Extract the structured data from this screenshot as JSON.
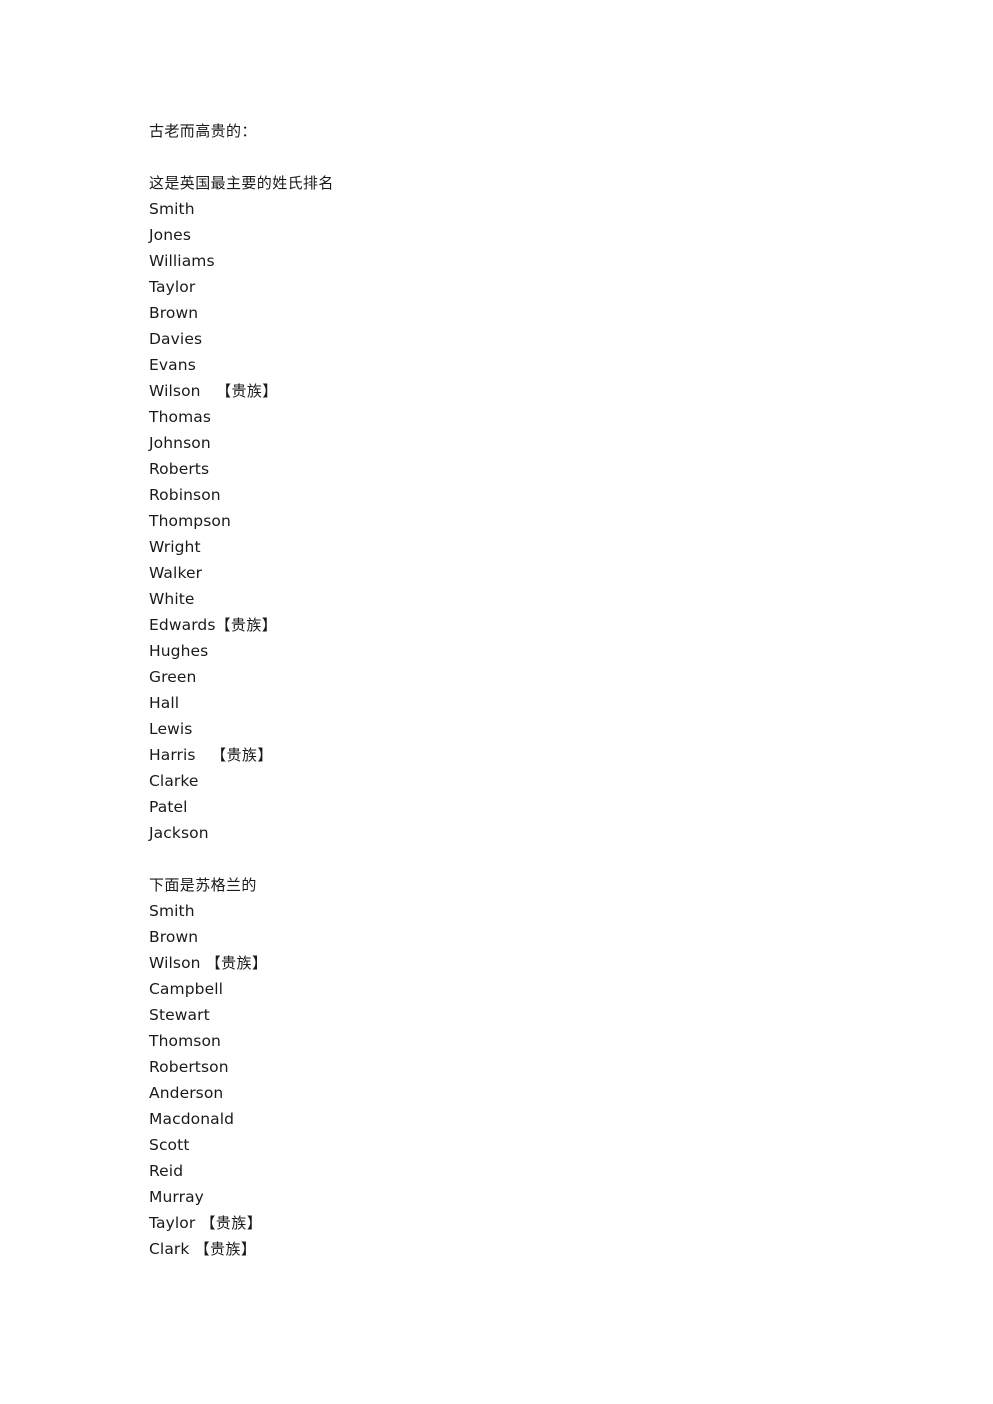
{
  "document": {
    "heading": "古老而高贵的：",
    "sections": [
      {
        "title": "这是英国最主要的姓氏排名",
        "entries": [
          {
            "name": "Smith",
            "gap": "",
            "tag": ""
          },
          {
            "name": "Jones",
            "gap": "",
            "tag": ""
          },
          {
            "name": "Williams",
            "gap": "",
            "tag": ""
          },
          {
            "name": "Taylor",
            "gap": "",
            "tag": ""
          },
          {
            "name": "Brown",
            "gap": "",
            "tag": ""
          },
          {
            "name": "Davies",
            "gap": "",
            "tag": ""
          },
          {
            "name": "Evans",
            "gap": "",
            "tag": ""
          },
          {
            "name": "Wilson",
            "gap": "   ",
            "tag": "【贵族】"
          },
          {
            "name": "Thomas",
            "gap": "",
            "tag": ""
          },
          {
            "name": "Johnson",
            "gap": "",
            "tag": ""
          },
          {
            "name": "Roberts",
            "gap": "",
            "tag": ""
          },
          {
            "name": "Robinson",
            "gap": "",
            "tag": ""
          },
          {
            "name": "Thompson",
            "gap": "",
            "tag": ""
          },
          {
            "name": "Wright",
            "gap": "",
            "tag": ""
          },
          {
            "name": "Walker",
            "gap": "",
            "tag": ""
          },
          {
            "name": "White",
            "gap": "",
            "tag": ""
          },
          {
            "name": "Edwards",
            "gap": "",
            "tag": "【贵族】"
          },
          {
            "name": "Hughes",
            "gap": "",
            "tag": ""
          },
          {
            "name": "Green",
            "gap": "",
            "tag": ""
          },
          {
            "name": "Hall",
            "gap": "",
            "tag": ""
          },
          {
            "name": "Lewis",
            "gap": "",
            "tag": ""
          },
          {
            "name": "Harris",
            "gap": "   ",
            "tag": "【贵族】"
          },
          {
            "name": "Clarke",
            "gap": "",
            "tag": ""
          },
          {
            "name": "Patel",
            "gap": "",
            "tag": ""
          },
          {
            "name": "Jackson",
            "gap": "",
            "tag": ""
          }
        ]
      },
      {
        "title": "下面是苏格兰的",
        "entries": [
          {
            "name": "Smith",
            "gap": "",
            "tag": ""
          },
          {
            "name": "Brown",
            "gap": "",
            "tag": ""
          },
          {
            "name": "Wilson",
            "gap": " ",
            "tag": "【贵族】"
          },
          {
            "name": "Campbell",
            "gap": "",
            "tag": ""
          },
          {
            "name": "Stewart",
            "gap": "",
            "tag": ""
          },
          {
            "name": "Thomson",
            "gap": "",
            "tag": ""
          },
          {
            "name": "Robertson",
            "gap": "",
            "tag": ""
          },
          {
            "name": "Anderson",
            "gap": "",
            "tag": ""
          },
          {
            "name": "Macdonald",
            "gap": "",
            "tag": ""
          },
          {
            "name": "Scott",
            "gap": "",
            "tag": ""
          },
          {
            "name": "Reid",
            "gap": "",
            "tag": ""
          },
          {
            "name": "Murray",
            "gap": "",
            "tag": ""
          },
          {
            "name": "Taylor",
            "gap": " ",
            "tag": "【贵族】"
          },
          {
            "name": "Clark",
            "gap": " ",
            "tag": "【贵族】"
          }
        ]
      }
    ]
  }
}
